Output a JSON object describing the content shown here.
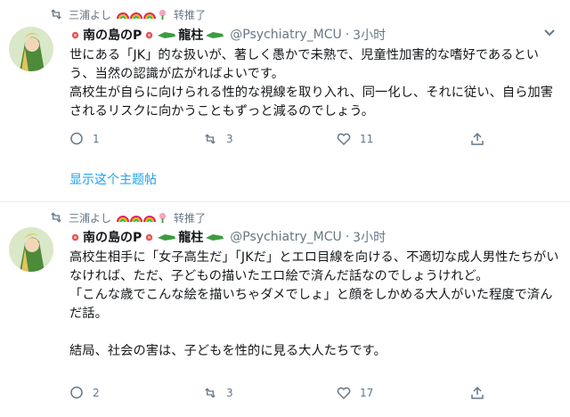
{
  "tweets": [
    {
      "retweeter": "三浦よし",
      "retweet_label": "转推了",
      "display_name_a": "南の島のP",
      "display_name_b": "龍柱",
      "handle": "@Psychiatry_MCU",
      "sep": "·",
      "time": "3小时",
      "text": "世にある「JK」的な扱いが、著しく愚かで未熟で、児童性加害的な嗜好であるという、当然の認識が広がればよいです。\n高校生が自らに向けられる性的な視線を取り入れ、同一化し、それに従い、自ら加害されるリスクに向かうこともずっと減るのでしょう。",
      "reply_count": "1",
      "retweet_count": "3",
      "like_count": "11",
      "thread_link": "显示这个主题帖"
    },
    {
      "retweeter": "三浦よし",
      "retweet_label": "转推了",
      "display_name_a": "南の島のP",
      "display_name_b": "龍柱",
      "handle": "@Psychiatry_MCU",
      "sep": "·",
      "time": "3小时",
      "text": "高校生相手に「女子高生だ」「JKだ」とエロ目線を向ける、不適切な成人男性たちがいなければ、ただ、子どもの描いたエロ絵で済んだ話なのでしょうけれど。\n「こんな歳でこんな絵を描いちゃダメでしょ」と顔をしかめる大人がいた程度で済んだ話。\n\n結局、社会の害は、子どもを性的に見る大人たちです。",
      "reply_count": "2",
      "retweet_count": "3",
      "like_count": "17"
    }
  ],
  "colors": {
    "muted": "#657786",
    "link": "#1da1f2",
    "text": "#14171a",
    "divider": "#e6ecf0"
  },
  "icons": [
    "retweet-icon",
    "rainbow-emoji",
    "flower-emoji",
    "crocodile-emoji",
    "reply-icon",
    "like-icon",
    "share-icon",
    "chevron-down-icon"
  ]
}
